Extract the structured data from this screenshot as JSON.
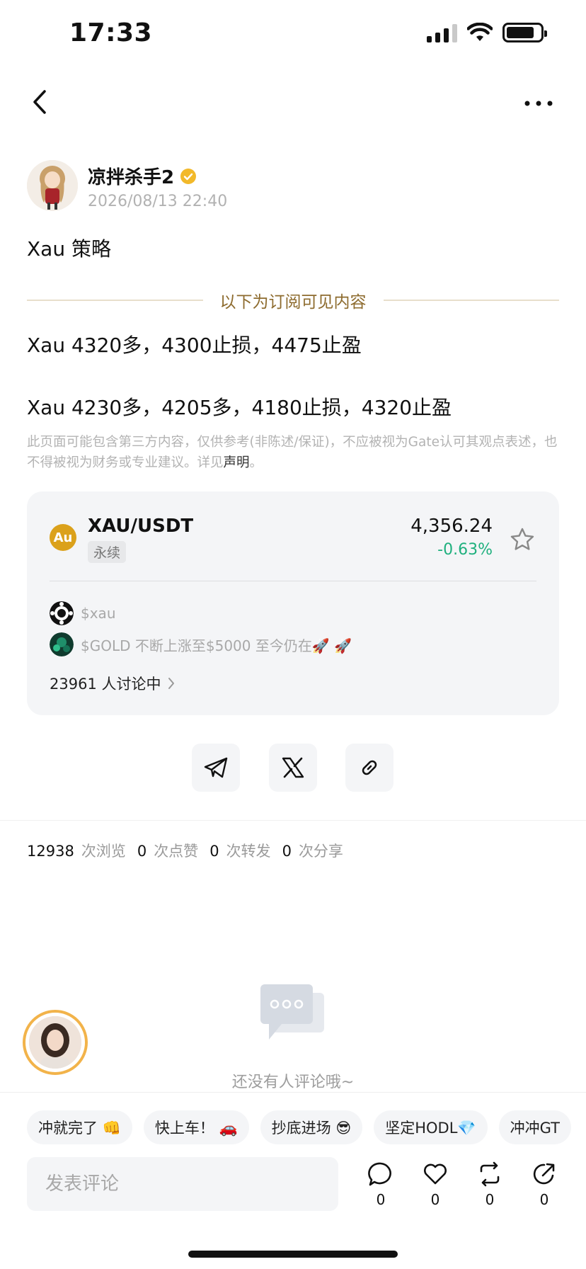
{
  "status_bar": {
    "time": "17:33"
  },
  "author": {
    "name": "凉拌杀手2",
    "time": "2026/08/13 22:40"
  },
  "post": {
    "title": "Xau 策略",
    "subscriber_divider": "以下为订阅可见内容",
    "lines": [
      "Xau 4320多，4300止损，4475止盈",
      "Xau 4230多，4205多，4180止损，4320止盈"
    ],
    "disclaimer_text": "此页面可能包含第三方内容，仅供参考(非陈述/保证)，不应被视为Gate认可其观点表述，也不得被视为财务或专业建议。详见",
    "disclaimer_link": "声明",
    "disclaimer_end": "。"
  },
  "market": {
    "coin_badge": "Au",
    "pair": "XAU/USDT",
    "tag": "永续",
    "price": "4,356.24",
    "change": "-0.63%",
    "change_color": "#1fb07e",
    "topics": [
      {
        "text": "$xau"
      },
      {
        "text": "$GOLD  不断上涨至$5000 至今仍在🚀 🚀"
      }
    ],
    "discussion": "23961 人讨论中"
  },
  "stats": [
    {
      "num": "12938",
      "label": "次浏览"
    },
    {
      "num": "0",
      "label": "次点赞"
    },
    {
      "num": "0",
      "label": "次转发"
    },
    {
      "num": "0",
      "label": "次分享"
    }
  ],
  "comments": {
    "empty_text": "还没有人评论哦~"
  },
  "quick_replies": [
    "冲就完了 👊",
    "快上车！ 🚗",
    "抄底进场 😎",
    "坚定HODL💎",
    "冲冲GT"
  ],
  "bottom": {
    "input_placeholder": "发表评论",
    "actions": [
      {
        "icon": "comment-icon",
        "count": "0"
      },
      {
        "icon": "heart-icon",
        "count": "0"
      },
      {
        "icon": "repost-icon",
        "count": "0"
      },
      {
        "icon": "share-icon",
        "count": "0"
      }
    ]
  },
  "colors": {
    "accent_gold": "#dba11b",
    "positive_green": "#1fb07e",
    "divider_text": "#8d6b2e"
  }
}
